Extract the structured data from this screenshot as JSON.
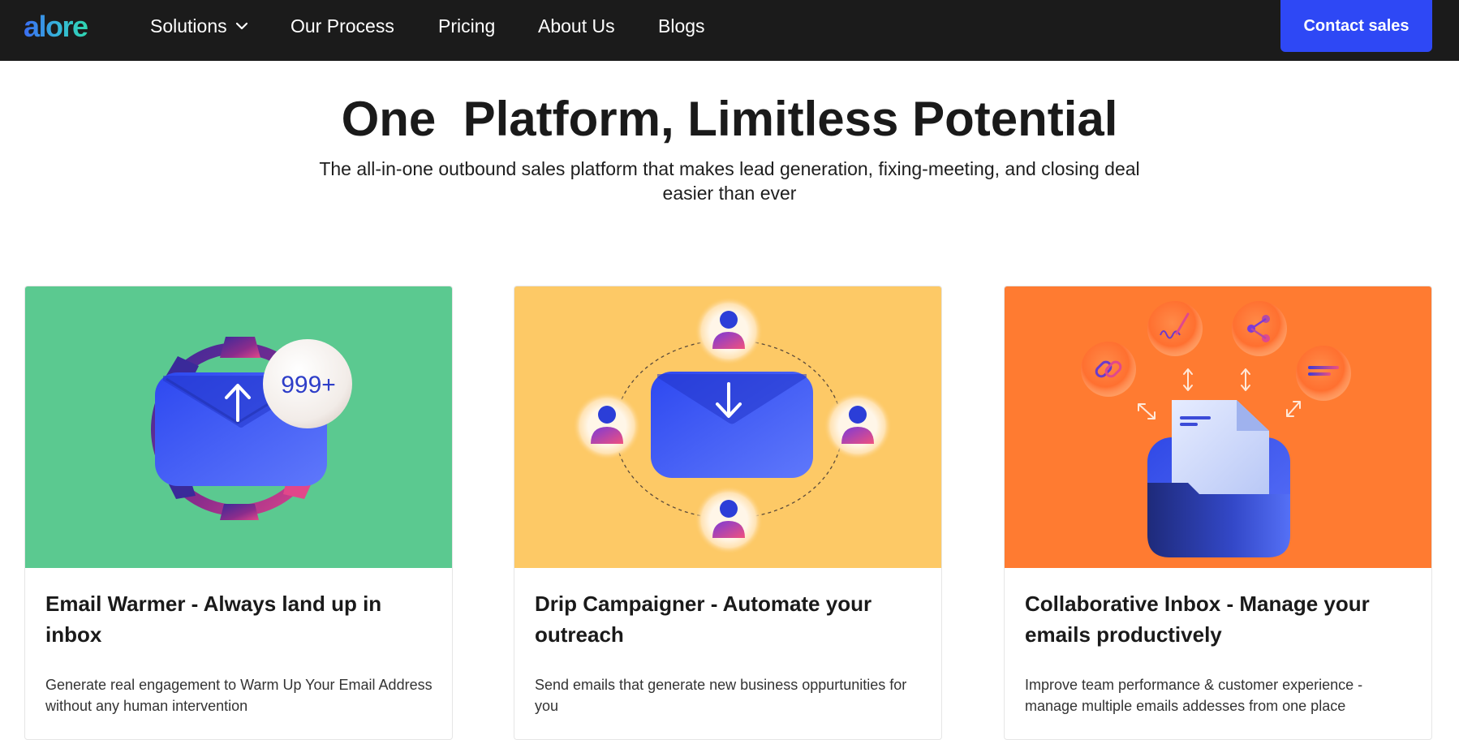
{
  "header": {
    "logo": "alore",
    "nav": [
      {
        "label": "Solutions"
      },
      {
        "label": "Our Process"
      },
      {
        "label": "Pricing"
      },
      {
        "label": "About Us"
      },
      {
        "label": "Blogs"
      }
    ],
    "contact_label": "Contact sales"
  },
  "hero": {
    "title": "One  Platform, Limitless Potential",
    "subtitle": "The all-in-one outbound sales platform that makes lead generation, fixing-meeting, and closing deal easier than ever"
  },
  "cards": [
    {
      "title": "Email Warmer - Always land up in inbox",
      "description": "Generate real engagement to Warm Up Your Email Address without any human intervention",
      "badge": "999+",
      "bg_color": "#5bc990",
      "icon": "email-upload-gear-icon"
    },
    {
      "title": "Drip Campaigner - Automate your outreach",
      "description": "Send emails that generate new business oppurtunities for you",
      "bg_color": "#fdc966",
      "icon": "email-download-people-icon"
    },
    {
      "title": "Collaborative Inbox - Manage your emails productively",
      "description": "Improve team performance & customer experience - manage multiple emails addesses from one place",
      "bg_color": "#ff7b31",
      "icon": "shared-folder-inbox-icon"
    }
  ],
  "colors": {
    "nav_bg": "#1b1b1b",
    "accent": "#2e48f5",
    "text": "#1a1a1a"
  }
}
